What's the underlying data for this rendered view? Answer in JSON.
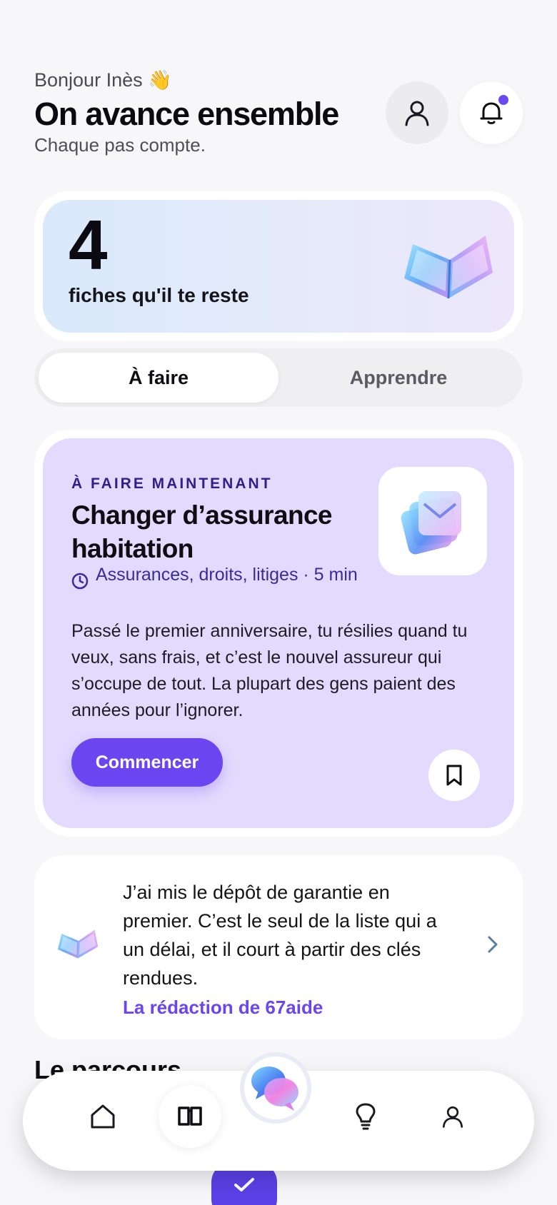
{
  "header": {
    "greeting": "Bonjour Inès 👋",
    "title": "On avance ensemble",
    "subtitle": "Chaque pas compte."
  },
  "count_card": {
    "count": "4",
    "label": "fiches qu'il te reste"
  },
  "tabs": [
    {
      "label": "À faire",
      "active": true
    },
    {
      "label": "Apprendre",
      "active": false
    }
  ],
  "task": {
    "eyebrow": "À FAIRE MAINTENANT",
    "title": "Changer d’assurance habitation",
    "meta": "Assurances, droits, litiges · 5 min",
    "description": "Passé le premier anniversaire, tu résilies quand tu veux, sans frais, et c’est le nouvel assureur qui s’occupe de tout. La plupart des gens paient des années pour l’ignorer.",
    "start_label": "Commencer"
  },
  "quote": {
    "text": "J’ai mis le dépôt de garantie en premier. C’est le seul de la liste qui a un délai, et il court à partir des clés rendues.",
    "author": "La rédaction de 67aide"
  },
  "section": {
    "title": "Le parcours"
  },
  "nav": {
    "items": [
      "home-icon",
      "book-icon",
      "chat-bubbles-icon",
      "lightbulb-icon",
      "profile-icon"
    ],
    "active": "book-icon"
  },
  "colors": {
    "accent": "#6a45f0",
    "task_bg": "#e3dbfd",
    "eyebrow": "#2f1f8a",
    "page_bg": "#f7f7f9"
  }
}
